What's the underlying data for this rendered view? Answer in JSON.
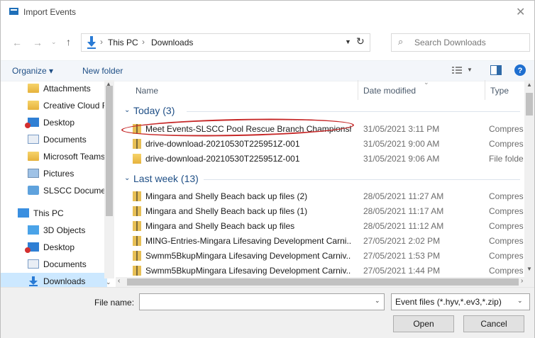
{
  "window": {
    "title": "Import Events",
    "close_glyph": "✕"
  },
  "addressbar": {
    "crumbs": [
      "This PC",
      "Downloads"
    ],
    "search_placeholder": "Search Downloads"
  },
  "toolbar": {
    "organize": "Organize ▾",
    "new_folder": "New folder"
  },
  "nav": {
    "items": [
      {
        "label": "Attachments"
      },
      {
        "label": "Creative Cloud F"
      },
      {
        "label": "Desktop"
      },
      {
        "label": "Documents"
      },
      {
        "label": "Microsoft Teams"
      },
      {
        "label": "Pictures"
      },
      {
        "label": "SLSCC Documer"
      },
      {
        "label": "This PC"
      },
      {
        "label": "3D Objects"
      },
      {
        "label": "Desktop"
      },
      {
        "label": "Documents"
      },
      {
        "label": "Downloads"
      }
    ]
  },
  "columns": {
    "name": "Name",
    "date": "Date modified",
    "type": "Type"
  },
  "groups": [
    {
      "label": "Today (3)",
      "rows": [
        {
          "name": "Meet Events-SLSCC Pool Rescue Branch Championshi...",
          "date": "31/05/2021 3:11 PM",
          "type": "Compres",
          "icon": "zip"
        },
        {
          "name": "drive-download-20210530T225951Z-001",
          "date": "31/05/2021 9:00 AM",
          "type": "Compres",
          "icon": "zip"
        },
        {
          "name": "drive-download-20210530T225951Z-001",
          "date": "31/05/2021 9:06 AM",
          "type": "File folde",
          "icon": "folder"
        }
      ]
    },
    {
      "label": "Last week (13)",
      "rows": [
        {
          "name": "Mingara and Shelly Beach back up files (2)",
          "date": "28/05/2021 11:27 AM",
          "type": "Compres",
          "icon": "zip"
        },
        {
          "name": "Mingara and Shelly Beach back up files (1)",
          "date": "28/05/2021 11:17 AM",
          "type": "Compres",
          "icon": "zip"
        },
        {
          "name": "Mingara and Shelly Beach back up files",
          "date": "28/05/2021 11:12 AM",
          "type": "Compres",
          "icon": "zip"
        },
        {
          "name": "MING-Entries-Mingara Lifesaving Development Carni...",
          "date": "27/05/2021 2:02 PM",
          "type": "Compres",
          "icon": "zip"
        },
        {
          "name": "Swmm5BkupMingara Lifesaving Development Carniv...",
          "date": "27/05/2021 1:53 PM",
          "type": "Compres",
          "icon": "zip"
        },
        {
          "name": "Swmm5BkupMingara Lifesaving Development Carniv...",
          "date": "27/05/2021 1:44 PM",
          "type": "Compres",
          "icon": "zip"
        }
      ]
    }
  ],
  "footer": {
    "file_name_label": "File name:",
    "file_name_value": "",
    "file_type": "Event files (*.hyv,*.ev3,*.zip)",
    "open": "Open",
    "cancel": "Cancel"
  },
  "accent": "#1f4f86",
  "annotation_color": "#c62828"
}
